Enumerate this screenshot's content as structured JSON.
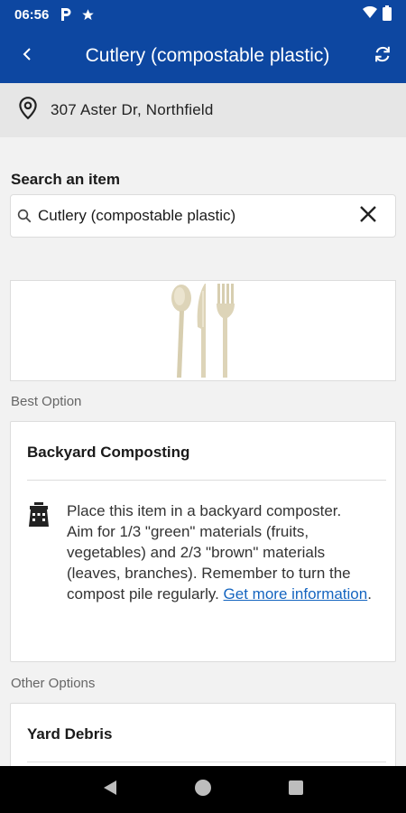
{
  "status_bar": {
    "time": "06:56"
  },
  "app_bar": {
    "title": "Cutlery (compostable plastic)"
  },
  "address": {
    "text": "307 Aster Dr, Northfield"
  },
  "search": {
    "label": "Search an item",
    "value": "Cutlery (compostable plastic)"
  },
  "best_option": {
    "section_label": "Best Option",
    "title": "Backyard Composting",
    "text": "Place this item in a backyard composter.\nAim for 1/3 \"green\" materials (fruits, vegetables) and 2/3 \"brown\" materials (leaves, branches). Remember to turn the compost pile regularly. ",
    "link_text": "Get more information",
    "trailing": "."
  },
  "other_options": {
    "section_label": "Other Options",
    "title": "Yard Debris"
  },
  "colors": {
    "primary": "#0d47a1",
    "link": "#1565c0",
    "address_bg": "#e6e6e6",
    "page_bg": "#f2f2f2"
  },
  "icons": {
    "status": [
      "p-icon",
      "star-icon",
      "wifi-icon",
      "battery-icon"
    ],
    "app_bar": [
      "back-arrow-icon",
      "refresh-icon"
    ],
    "address": "location-pin-icon",
    "search": [
      "search-icon",
      "clear-icon"
    ],
    "option": "compost-bin-icon",
    "nav": [
      "nav-back-icon",
      "nav-home-icon",
      "nav-recents-icon"
    ]
  }
}
